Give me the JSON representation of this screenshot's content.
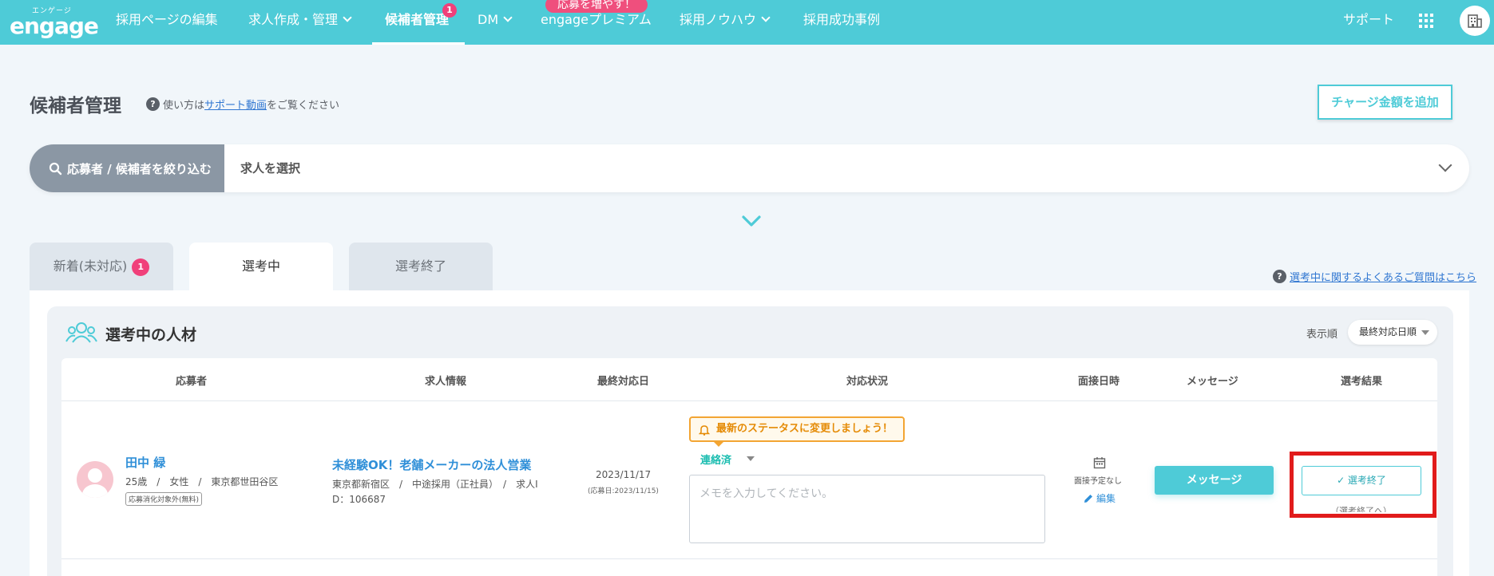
{
  "header": {
    "logo_sub": "エンゲージ",
    "logo_main": "engage",
    "nav": [
      {
        "label": "採用ページの編集"
      },
      {
        "label": "求人作成・管理"
      },
      {
        "label": "候補者管理",
        "badge": "1"
      },
      {
        "label": "DM"
      },
      {
        "label": "engageプレミアム",
        "promo": "応募を増やす！"
      },
      {
        "label": "採用ノウハウ"
      },
      {
        "label": "採用成功事例"
      }
    ],
    "support": "サポート"
  },
  "page": {
    "title": "候補者管理",
    "help_prefix": "使い方は",
    "help_link": "サポート動画",
    "help_suffix": "をご覧ください",
    "charge_button": "チャージ金額を追加"
  },
  "filter": {
    "label": "応募者 / 候補者を絞り込む",
    "select": "求人を選択"
  },
  "tabs": [
    {
      "label": "新着(未対応)",
      "badge": "1"
    },
    {
      "label": "選考中"
    },
    {
      "label": "選考終了"
    }
  ],
  "faq_link": "選考中に関するよくあるご質問はこちら",
  "section": {
    "title": "選考中の人材",
    "sort_label": "表示順",
    "sort_value": "最終対応日順"
  },
  "table": {
    "headers": [
      "応募者",
      "求人情報",
      "最終対応日",
      "対応状況",
      "面接日時",
      "メッセージ",
      "選考結果"
    ],
    "rows": [
      {
        "name": "田中 緑",
        "meta": "25歳　/　女性　/　東京都世田谷区",
        "tag": "応募消化対象外(無料)",
        "job_title": "未経験OK！老舗メーカーの法人営業",
        "job_meta1": "東京都新宿区　/　中途採用（正社員）　/　求人I",
        "job_meta2": "D：106687",
        "last_date": "2023/11/17",
        "applied_date": "(応募日:2023/11/15)",
        "status_tip": "最新のステータスに変更しましょう！",
        "status": "連絡済",
        "memo_placeholder": "メモを入力してください。",
        "interview": "面接予定なし",
        "edit": "編集",
        "message_button": "メッセージ",
        "end_button": "✓ 選考終了",
        "end_sub": "（選考終了へ）"
      }
    ]
  }
}
